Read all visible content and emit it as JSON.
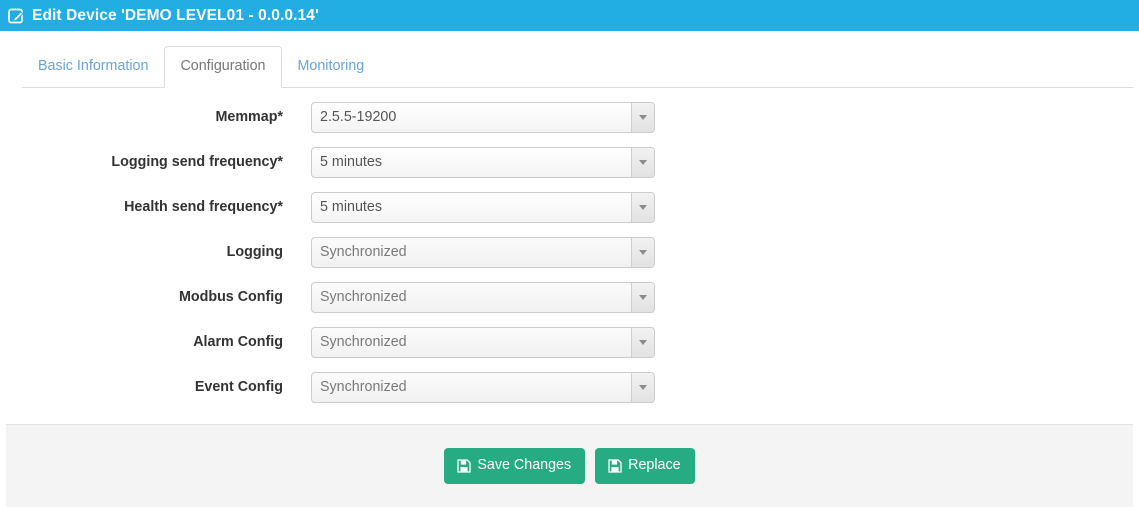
{
  "titlebar": {
    "icon": "edit-square-pencil-icon",
    "title": "Edit Device 'DEMO LEVEL01 - 0.0.0.14'",
    "background_color": "#22ade3",
    "text_color": "#ffffff"
  },
  "tabs": [
    {
      "label": "Basic Information",
      "active": false
    },
    {
      "label": "Configuration",
      "active": true
    },
    {
      "label": "Monitoring",
      "active": false
    }
  ],
  "form": {
    "rows": [
      {
        "label": "Memmap*",
        "value": "2.5.5-19200",
        "muted": false,
        "arrow_icon": "chevron-down-icon"
      },
      {
        "label": "Logging send frequency*",
        "value": "5 minutes",
        "muted": false,
        "arrow_icon": "chevron-down-icon"
      },
      {
        "label": "Health send frequency*",
        "value": "5 minutes",
        "muted": false,
        "arrow_icon": "chevron-down-icon"
      },
      {
        "label": "Logging",
        "value": "Synchronized",
        "muted": true,
        "arrow_icon": "chevron-down-icon"
      },
      {
        "label": "Modbus Config",
        "value": "Synchronized",
        "muted": true,
        "arrow_icon": "chevron-down-icon"
      },
      {
        "label": "Alarm Config",
        "value": "Synchronized",
        "muted": true,
        "arrow_icon": "chevron-down-icon"
      },
      {
        "label": "Event Config",
        "value": "Synchronized",
        "muted": true,
        "arrow_icon": "chevron-down-icon"
      }
    ]
  },
  "footer": {
    "background_color": "#f4f4f4",
    "buttons": [
      {
        "label": "Save Changes",
        "icon": "floppy-save-icon",
        "color": "#26ab83"
      },
      {
        "label": "Replace",
        "icon": "floppy-save-icon",
        "color": "#26ab83"
      }
    ]
  }
}
